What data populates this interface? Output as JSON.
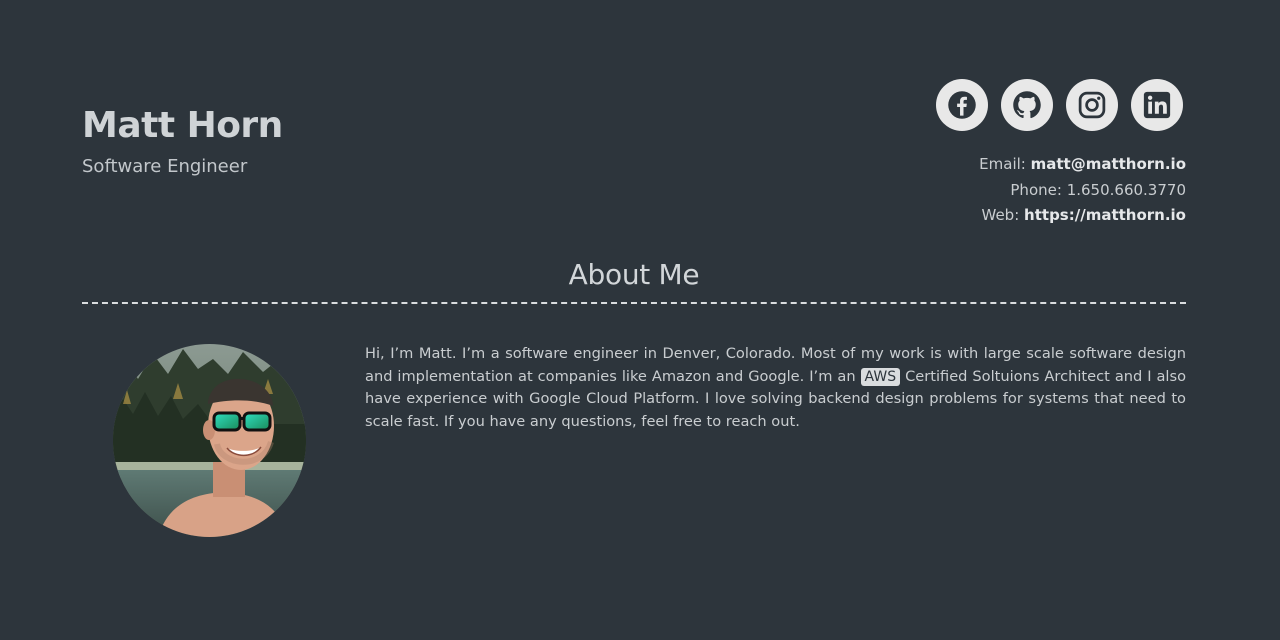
{
  "header": {
    "name": "Matt Horn",
    "title": "Software Engineer"
  },
  "socials": [
    {
      "name": "facebook",
      "icon": "facebook-icon"
    },
    {
      "name": "github",
      "icon": "github-icon"
    },
    {
      "name": "instagram",
      "icon": "instagram-icon"
    },
    {
      "name": "linkedin",
      "icon": "linkedin-icon"
    }
  ],
  "contact": {
    "email_label": "Email:",
    "email_value": "matt@matthorn.io",
    "phone_label": "Phone:",
    "phone_value": "1.650.660.3770",
    "web_label": "Web:",
    "web_value": "https://matthorn.io"
  },
  "about": {
    "heading": "About Me",
    "bio_part1": "Hi, I’m Matt. I’m a software engineer in Denver, Colorado. Most of my work is with large scale software design and implementation at companies like Amazon and Google. I’m an",
    "badge": "AWS",
    "bio_part2": "Certified Soltuions Architect and I also have experience with Google Cloud Platform. I love solving backend design problems for systems that need to scale fast. If you have any questions, feel free to reach out."
  },
  "colors": {
    "background": "#2d353c",
    "text": "#d9dcde",
    "icon_bg": "#e8e8e8",
    "icon_fg": "#2d353c"
  }
}
